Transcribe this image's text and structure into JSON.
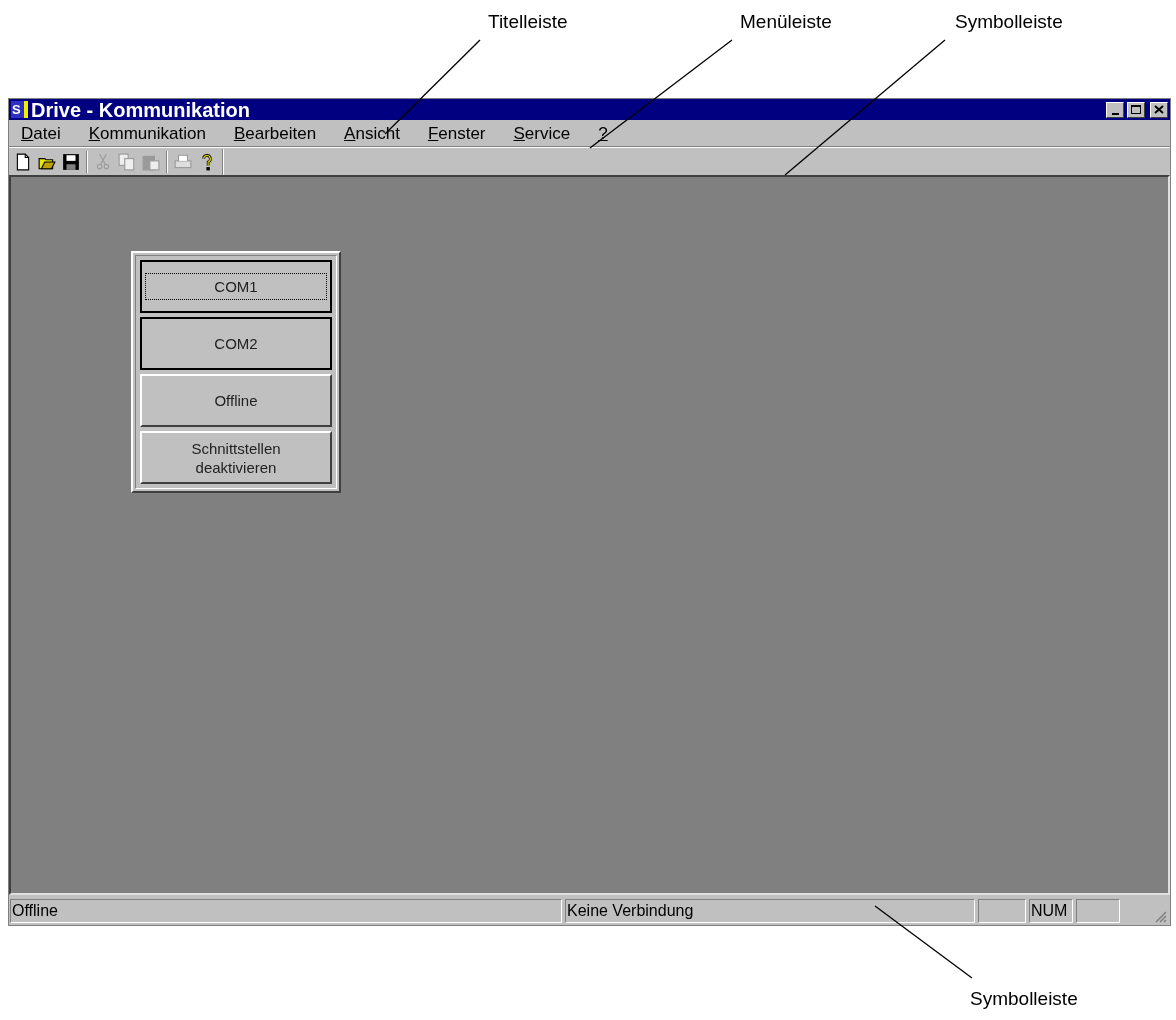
{
  "annotations": [
    {
      "label": "Titelleiste"
    },
    {
      "label": "Menüleiste"
    },
    {
      "label": "Symbolleiste"
    },
    {
      "label": "Symbolleiste"
    }
  ],
  "window": {
    "title": "Drive - Kommunikation",
    "app_icon": "S"
  },
  "menu": [
    {
      "label": "Datei"
    },
    {
      "label": "Kommunikation"
    },
    {
      "label": "Bearbeiten"
    },
    {
      "label": "Ansicht"
    },
    {
      "label": "Fenster"
    },
    {
      "label": "Service"
    },
    {
      "label": "?"
    }
  ],
  "toolbar": [
    {
      "kind": "new",
      "disabled": false
    },
    {
      "kind": "open",
      "disabled": false
    },
    {
      "kind": "save",
      "disabled": false
    },
    {
      "kind": "separator"
    },
    {
      "kind": "cut",
      "disabled": true
    },
    {
      "kind": "copy",
      "disabled": true
    },
    {
      "kind": "paste",
      "disabled": true
    },
    {
      "kind": "separator"
    },
    {
      "kind": "print",
      "disabled": true
    },
    {
      "kind": "help",
      "disabled": false
    }
  ],
  "panel_buttons": [
    {
      "label": "COM1",
      "focused": true,
      "highlighted": true
    },
    {
      "label": "COM2",
      "focused": false,
      "highlighted": true
    },
    {
      "label": "Offline",
      "focused": false,
      "highlighted": false
    },
    {
      "label": "Schnittstellen deaktivieren",
      "focused": false,
      "highlighted": false
    }
  ],
  "status_bar": [
    {
      "kind": "text",
      "text": "Offline"
    },
    {
      "kind": "text",
      "text": "Keine Verbindung"
    },
    {
      "kind": "blank"
    },
    {
      "kind": "text",
      "text": "NUM"
    },
    {
      "kind": "blank"
    }
  ]
}
